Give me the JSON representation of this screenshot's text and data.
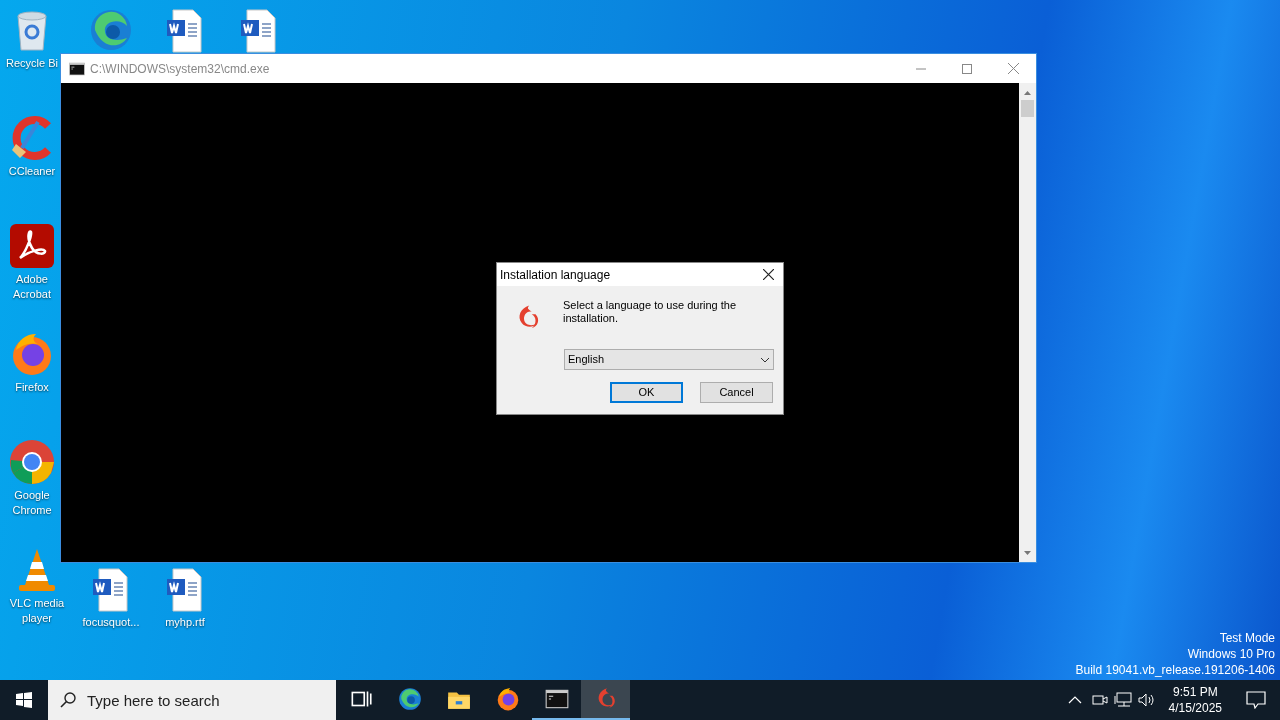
{
  "desktop_icons": [
    {
      "kind": "recycle",
      "label": "Recycle Bi"
    },
    {
      "kind": "edge"
    },
    {
      "kind": "word"
    },
    {
      "kind": "word"
    },
    {
      "kind": "ccleaner",
      "label": "CCleaner"
    },
    {
      "kind": "acrobat",
      "label": "Adobe Acrobat"
    },
    {
      "kind": "firefox",
      "label": "Firefox"
    },
    {
      "kind": "chrome",
      "label": "Google Chrome"
    },
    {
      "kind": "vlc",
      "label": "VLC media player"
    },
    {
      "kind": "word",
      "label": "focusquot..."
    },
    {
      "kind": "word",
      "label": "myhp.rtf"
    }
  ],
  "console_window": {
    "title": "C:\\WINDOWS\\system32\\cmd.exe"
  },
  "dialog": {
    "title": "Installation language",
    "message": "Select a language to use during the installation.",
    "language": "English",
    "buttons": [
      {
        "label": "OK",
        "selected": true
      },
      {
        "label": "Cancel",
        "selected": false
      }
    ]
  },
  "system_info": [
    "Test Mode",
    "Windows 10 Pro",
    "Build 19041.vb_release.191206-1406"
  ],
  "taskbar": {
    "search": {
      "placeholder": "Type here to search"
    },
    "apps": [
      {
        "kind": "taskview",
        "running": false,
        "selected": false
      },
      {
        "kind": "edge",
        "running": false,
        "selected": false
      },
      {
        "kind": "explorer",
        "running": false,
        "selected": false
      },
      {
        "kind": "firefox",
        "running": false,
        "selected": false
      },
      {
        "kind": "cmd",
        "running": true,
        "selected": false
      },
      {
        "kind": "installer",
        "running": true,
        "selected": true
      }
    ],
    "time": "9:51 PM",
    "date": "4/15/2025"
  }
}
